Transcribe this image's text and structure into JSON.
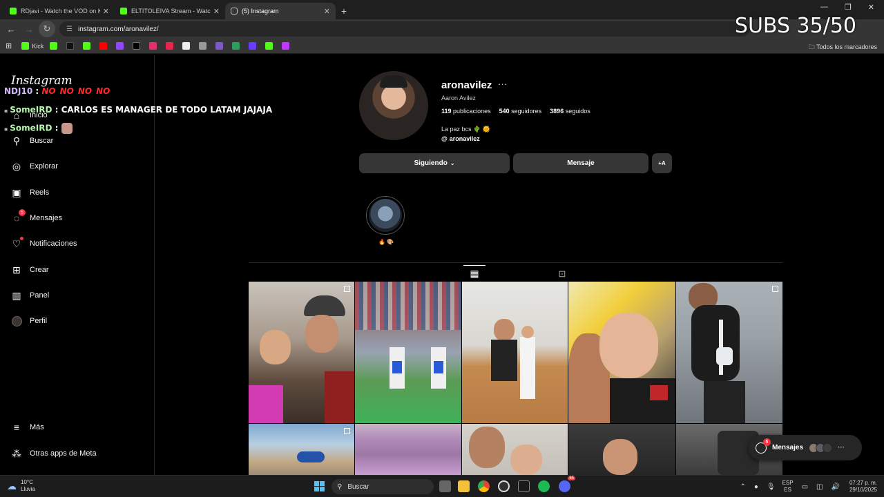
{
  "browser": {
    "tabs": [
      {
        "title": "RDjavi - Watch the VOD on Kick",
        "favicon": "kick-icon",
        "color": "#53fc18"
      },
      {
        "title": "ELTITOLEIVA Stream - Watch Live",
        "favicon": "kick-icon",
        "color": "#53fc18"
      },
      {
        "title": "(5) Instagram",
        "favicon": "instagram-icon",
        "color": "#ffffff"
      }
    ],
    "url": "instagram.com/aronavilez/",
    "bookmarks": [
      {
        "label": "Kick",
        "color": "#53fc18"
      },
      {
        "label": "",
        "color": "#53fc18"
      },
      {
        "label": "",
        "color": "#111111"
      },
      {
        "label": "",
        "color": "#53fc18"
      },
      {
        "label": "",
        "color": "#ff0000"
      },
      {
        "label": "",
        "color": "#9146ff"
      },
      {
        "label": "",
        "color": "#000000"
      },
      {
        "label": "",
        "color": "#e1306c"
      },
      {
        "label": "",
        "color": "#e8234d"
      },
      {
        "label": "",
        "color": "#eeeeee"
      },
      {
        "label": "",
        "color": "#999999"
      },
      {
        "label": "",
        "color": "#7f58c7"
      },
      {
        "label": "",
        "color": "#2e9e5e"
      },
      {
        "label": "",
        "color": "#6a3cff"
      },
      {
        "label": "",
        "color": "#53fc18"
      },
      {
        "label": "",
        "color": "#c038ff"
      }
    ],
    "all_bookmarks": "Todos los marcadores"
  },
  "overlay": {
    "subs": "SUBS 35/50",
    "chat": [
      {
        "user": "NDJ10",
        "text": "",
        "no": [
          "NO",
          "NO",
          "NO",
          "NO"
        ]
      },
      {
        "user": "SomeIRD",
        "text": "CARLOS ES MANAGER DE TODO LATAM JAJAJA"
      },
      {
        "user": "SomeIRD",
        "text": ""
      }
    ]
  },
  "sidebar": {
    "logo": "Instagram",
    "items": [
      {
        "label": "Inicio",
        "icon": "home-icon"
      },
      {
        "label": "Buscar",
        "icon": "search-icon"
      },
      {
        "label": "Explorar",
        "icon": "compass-icon"
      },
      {
        "label": "Reels",
        "icon": "reels-icon"
      },
      {
        "label": "Mensajes",
        "icon": "messenger-icon",
        "badge": "5"
      },
      {
        "label": "Notificaciones",
        "icon": "heart-icon"
      },
      {
        "label": "Crear",
        "icon": "plus-square-icon"
      },
      {
        "label": "Panel",
        "icon": "chart-icon"
      },
      {
        "label": "Perfil",
        "icon": "profile-avatar"
      },
      {
        "label": "Más",
        "icon": "menu-icon"
      },
      {
        "label": "Otras apps de Meta",
        "icon": "meta-apps-icon"
      }
    ]
  },
  "profile": {
    "username": "aronavilez",
    "full_name": "Aaron Avilez",
    "posts_count": "119",
    "posts_label": "publicaciones",
    "followers_count": "540",
    "followers_label": "seguidores",
    "following_count": "3896",
    "following_label": "seguidos",
    "bio": "La paz bcs 🌵 🌞",
    "threads_handle": "aronavilez",
    "following_button": "Siguiendo",
    "message_button": "Mensaje",
    "add_person_icon": "+A",
    "highlight_label": "🔥 🎨"
  },
  "messages_float": {
    "label": "Mensajes",
    "badge": "5"
  },
  "taskbar": {
    "weather_temp": "10°C",
    "weather_desc": "Lluvia",
    "search_placeholder": "Buscar",
    "lang_top": "ESP",
    "lang_bottom": "ES",
    "time": "07:27 p. m.",
    "date": "29/10/2025",
    "discord_badge": "65"
  }
}
